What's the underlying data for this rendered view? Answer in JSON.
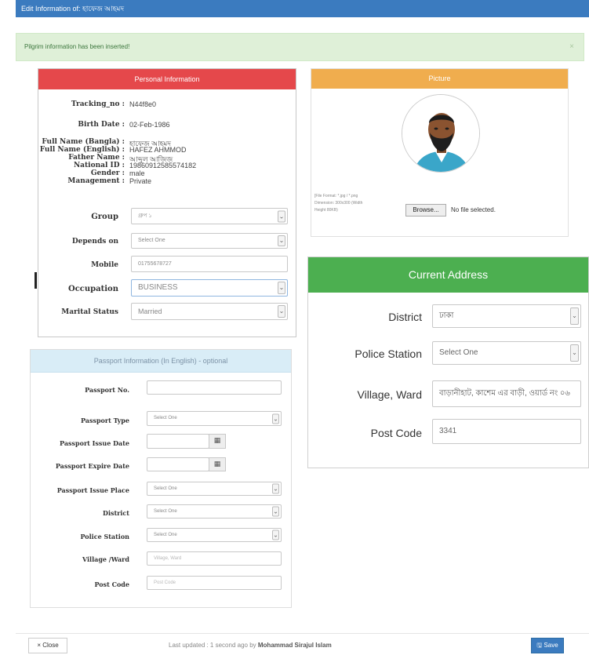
{
  "header": {
    "title": "Edit Information of: হাফেজ আহমদ"
  },
  "alert": {
    "message": "Pilgrim information has been inserted!",
    "close": "×"
  },
  "personal": {
    "heading": "Personal Information",
    "info": [
      {
        "label": "Tracking_no :",
        "value": "N44f8e0"
      },
      {
        "label": "Birth Date :",
        "value": "02-Feb-1986"
      },
      {
        "label": "Full Name (Bangla) :",
        "value": "হাফেজ আহমদ"
      },
      {
        "label": "Full Name (English) :",
        "value": "HAFEZ AHMMOD"
      },
      {
        "label": "Father Name :",
        "value": "আব্দুল আজিজ"
      },
      {
        "label": "National ID :",
        "value": "19860912585574182"
      },
      {
        "label": "Gender :",
        "value": "male"
      },
      {
        "label": "Management :",
        "value": "Private"
      }
    ],
    "fields": {
      "group": {
        "label": "Group",
        "value": "গ্রুপ ১"
      },
      "depends_on": {
        "label": "Depends on",
        "value": "Select One"
      },
      "mobile": {
        "label": "Mobile",
        "value": "01755678727"
      },
      "occupation": {
        "label": "Occupation",
        "value": "BUSINESS"
      },
      "marital_status": {
        "label": "Marital Status",
        "value": "Married"
      }
    }
  },
  "picture": {
    "heading": "Picture",
    "file_note": [
      "[File Format: *.jpg / *.png",
      "Dimension: 300x300 (Width",
      "Height 80KB)"
    ],
    "browse_label": "Browse...",
    "no_file": "No file selected."
  },
  "address": {
    "heading": "Current Address",
    "district": {
      "label": "District",
      "value": "ঢাকা"
    },
    "police_station": {
      "label": "Police Station",
      "value": "Select One"
    },
    "village": {
      "label": "Village, Ward",
      "value": "বাড়ানীহাট, কাশেম এর বাড়ী, ওয়ার্ড নং ০৬"
    },
    "post_code": {
      "label": "Post Code",
      "value": "3341"
    }
  },
  "passport": {
    "heading": "Passport Information (In English) - optional",
    "passport_no": {
      "label": "Passport No.",
      "value": ""
    },
    "passport_type": {
      "label": "Passport Type",
      "value": "Select One"
    },
    "issue_date": {
      "label": "Passport Issue Date",
      "value": ""
    },
    "expire_date": {
      "label": "Passport Expire Date",
      "value": ""
    },
    "issue_place": {
      "label": "Passport Issue Place",
      "value": "Select One"
    },
    "district": {
      "label": "District",
      "value": "Select One"
    },
    "police_station": {
      "label": "Police Station",
      "value": "Select One"
    },
    "village": {
      "label": "Village /Ward",
      "placeholder": "Village, Ward"
    },
    "post_code": {
      "label": "Post Code",
      "placeholder": "Post Code"
    }
  },
  "footer": {
    "close_label": "× Close",
    "updated_prefix": "Last updated : 1 second ago by",
    "updated_user": "Mohammad Sirajul Islam",
    "save_label": "Save"
  },
  "icons": {
    "chevron": "chevron-down-icon",
    "calendar": "calendar-icon"
  },
  "colors": {
    "header": "#3b7bbf",
    "personal": "#e5484b",
    "picture": "#f0ad4e",
    "address": "#4caf50",
    "passport": "#d9edf7"
  }
}
